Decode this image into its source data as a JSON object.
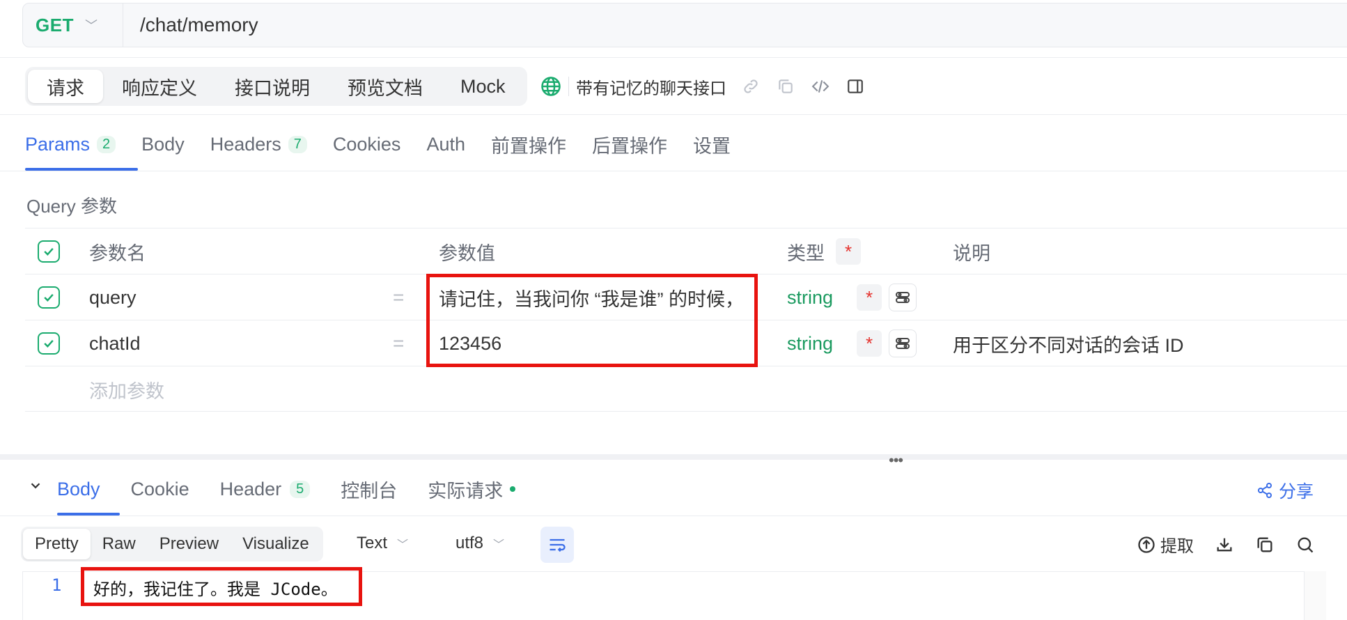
{
  "request": {
    "method": "GET",
    "url": "/chat/memory"
  },
  "top_tabs": [
    "请求",
    "响应定义",
    "接口说明",
    "预览文档",
    "Mock"
  ],
  "api_name": "带有记忆的聊天接口",
  "param_tabs": [
    {
      "label": "Params",
      "badge": "2"
    },
    {
      "label": "Body",
      "badge": ""
    },
    {
      "label": "Headers",
      "badge": "7"
    },
    {
      "label": "Cookies",
      "badge": ""
    },
    {
      "label": "Auth",
      "badge": ""
    },
    {
      "label": "前置操作",
      "badge": ""
    },
    {
      "label": "后置操作",
      "badge": ""
    },
    {
      "label": "设置",
      "badge": ""
    }
  ],
  "query_title": "Query 参数",
  "table": {
    "headers": {
      "name": "参数名",
      "value": "参数值",
      "type": "类型",
      "required": "*",
      "desc": "说明"
    },
    "rows": [
      {
        "name": "query",
        "eq": "=",
        "value": "请记住，当我问你 “我是谁” 的时候，",
        "type": "string",
        "required": "*",
        "desc": ""
      },
      {
        "name": "chatId",
        "eq": "=",
        "value": "123456",
        "type": "string",
        "required": "*",
        "desc": "用于区分不同对话的会话 ID"
      }
    ],
    "add_placeholder": "添加参数"
  },
  "response": {
    "tabs": [
      {
        "label": "Body",
        "badge": ""
      },
      {
        "label": "Cookie",
        "badge": ""
      },
      {
        "label": "Header",
        "badge": "5"
      },
      {
        "label": "控制台",
        "badge": ""
      },
      {
        "label": "实际请求",
        "badge": ""
      }
    ],
    "share": "分享",
    "formats": [
      "Pretty",
      "Raw",
      "Preview",
      "Visualize"
    ],
    "type_select": "Text",
    "encoding_select": "utf8",
    "extract": "提取",
    "line_number": "1",
    "body": "好的，我记住了。我是 JCode。"
  },
  "colors": {
    "accent": "#3b6ee8",
    "success": "#1aab6e",
    "highlight": "#e8130f"
  }
}
